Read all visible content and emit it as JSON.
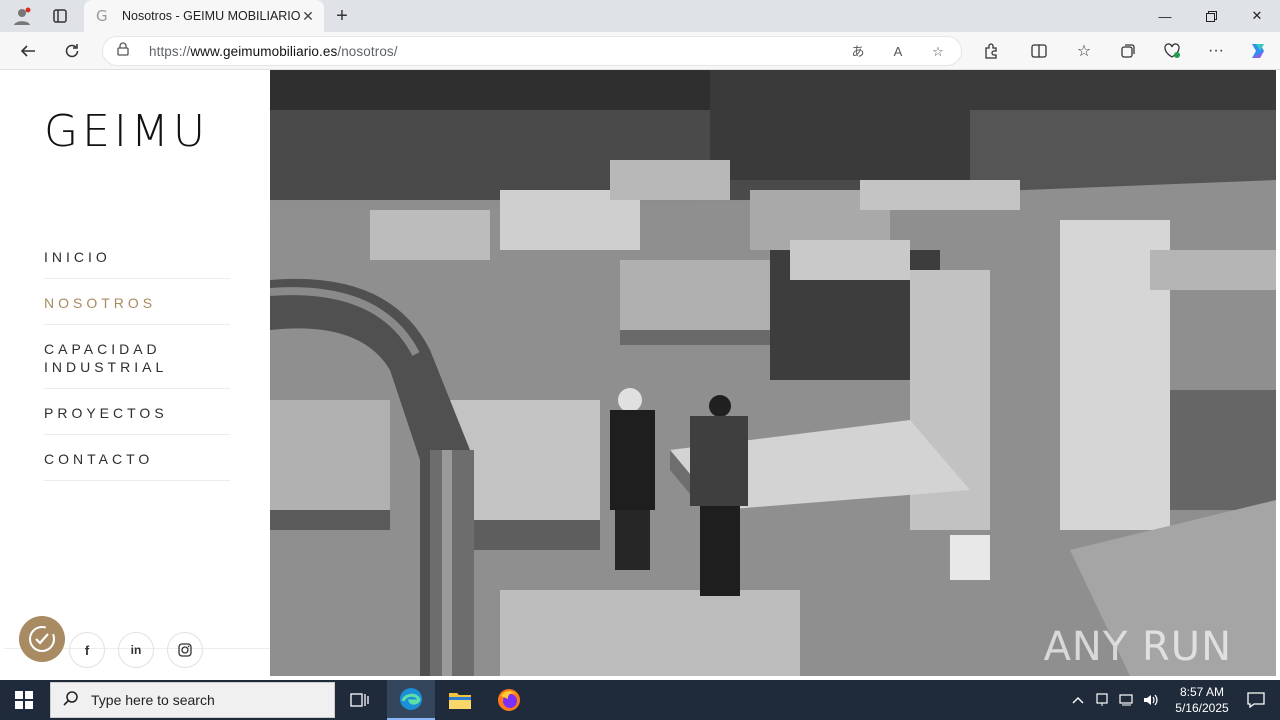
{
  "browser": {
    "tab_title": "Nosotros - GEIMU MOBILIARIO",
    "tab_favicon": "G",
    "url_prefix": "https://",
    "url_domain": "www.geimumobiliario.es",
    "url_path": "/nosotros/"
  },
  "site": {
    "logo": "GEIMU",
    "nav": [
      {
        "label": "INICIO"
      },
      {
        "label": "NOSOTROS"
      },
      {
        "label": "CAPACIDAD INDUSTRIAL"
      },
      {
        "label": "PROYECTOS"
      },
      {
        "label": "CONTACTO"
      }
    ],
    "active_nav": "NOSOTROS",
    "accent_color": "#a88b63",
    "social": [
      {
        "label": "f",
        "icon": "facebook-icon"
      },
      {
        "label": "in",
        "icon": "linkedin-icon"
      },
      {
        "label": "◎",
        "icon": "instagram-icon"
      }
    ]
  },
  "watermark": "ANY RUN",
  "taskbar": {
    "search_placeholder": "Type here to search",
    "time": "8:57 AM",
    "date": "5/16/2025"
  }
}
